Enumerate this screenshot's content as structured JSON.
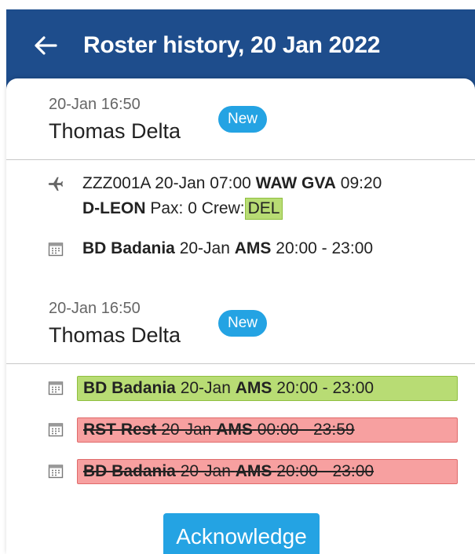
{
  "header": {
    "title": "Roster history, 20 Jan 2022",
    "back_icon": "arrow-left-icon"
  },
  "entries": [
    {
      "time": "20-Jan 16:50",
      "user": "Thomas Delta",
      "badge": "New",
      "flight": {
        "icon": "airplane-icon",
        "code": "ZZZ001A",
        "date_time": "20-Jan 07:00",
        "route": "WAW GVA",
        "arrival": "09:20",
        "registration": "D-LEON",
        "pax": "Pax: 0",
        "crew_label": "Crew:",
        "crew_value": "DEL"
      },
      "duty": {
        "icon": "calendar-icon",
        "code": "BD Badania",
        "date": "20-Jan",
        "place": "AMS",
        "time": "20:00 - 23:00"
      }
    },
    {
      "time": "20-Jan 16:50",
      "user": "Thomas Delta",
      "badge": "New",
      "changes": [
        {
          "status": "added",
          "icon": "calendar-icon",
          "code": "BD Badania",
          "date": "20-Jan",
          "place": "AMS",
          "time": "20:00 - 23:00"
        },
        {
          "status": "removed",
          "icon": "calendar-icon",
          "code": "RST Rest",
          "date": "20-Jan",
          "place": "AMS",
          "time": "00:00 - 23:59"
        },
        {
          "status": "removed",
          "icon": "calendar-icon",
          "code": "BD Badania",
          "date": "20-Jan",
          "place": "AMS",
          "time": "20:00 - 23:00"
        }
      ]
    }
  ],
  "actions": {
    "acknowledge_label": "Acknowledge"
  },
  "colors": {
    "appbar": "#1e4d8c",
    "accent": "#24a3e3",
    "added": "#b8dc74",
    "removed": "#f7a0a0"
  }
}
